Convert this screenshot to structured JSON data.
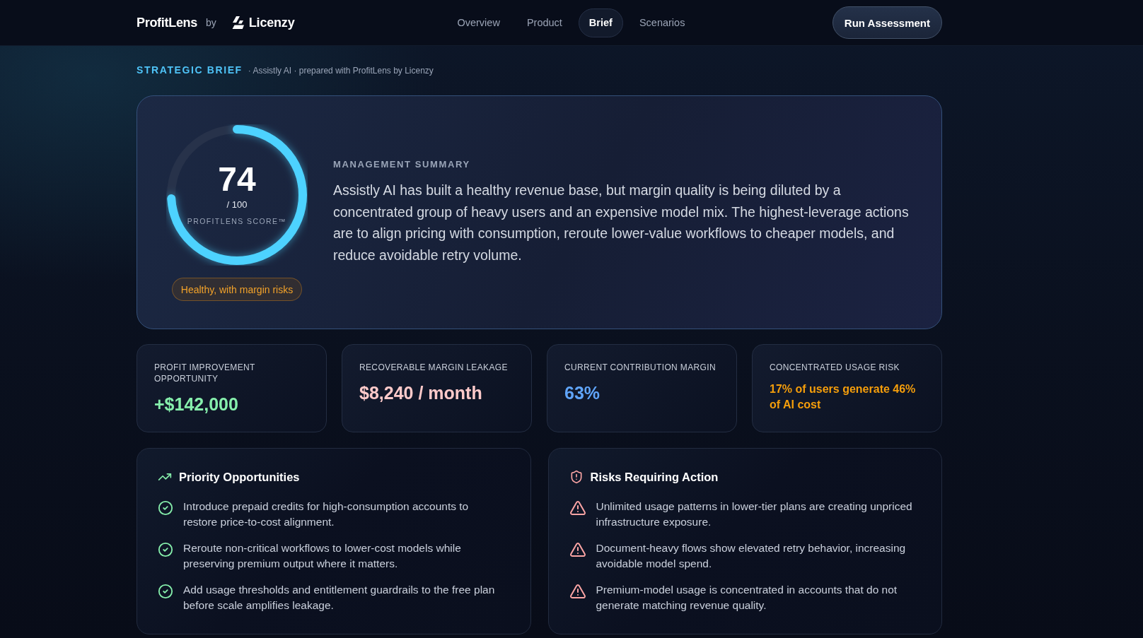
{
  "header": {
    "brand": "ProfitLens",
    "by": "by",
    "partner": "Licenzy",
    "nav": [
      {
        "label": "Overview",
        "selected": false
      },
      {
        "label": "Product",
        "selected": false
      },
      {
        "label": "Brief",
        "selected": true
      },
      {
        "label": "Scenarios",
        "selected": false
      }
    ],
    "cta": "Run Assessment"
  },
  "breadcrumb": {
    "title": "STRATEGIC BRIEF",
    "subtitle": "· Assistly AI · prepared with ProfitLens by Licenzy"
  },
  "score": {
    "value": "74",
    "scale": "/ 100",
    "label": "PROFITLENS SCORE™",
    "level": 0.74,
    "status": "Healthy, with margin risks"
  },
  "summary": {
    "label": "MANAGEMENT SUMMARY",
    "text": "Assistly AI has built a healthy revenue base, but margin quality is being diluted by a concentrated group of heavy users and an expensive model mix. The highest-leverage actions are to align pricing with consumption, reroute lower-value workflows to cheaper models, and reduce avoidable retry volume."
  },
  "metrics": [
    {
      "label": "PROFIT IMPROVEMENT OPPORTUNITY",
      "value": "+$142,000",
      "kind": "figure",
      "color": "#86efac"
    },
    {
      "label": "RECOVERABLE MARGIN LEAKAGE",
      "value": "$8,240 / month",
      "kind": "figure",
      "color": "#fecaca"
    },
    {
      "label": "CURRENT CONTRIBUTION MARGIN",
      "value": "63%",
      "kind": "figure",
      "color": "#60a5fa"
    },
    {
      "label": "CONCENTRATED USAGE RISK",
      "value": "17% of users generate 46% of AI cost",
      "kind": "statement",
      "color": "#f59e0b"
    }
  ],
  "panels": [
    {
      "kind": "opportunities",
      "title": "Priority Opportunities",
      "items": [
        "Introduce prepaid credits for high-consumption accounts to restore price-to-cost alignment.",
        "Reroute non-critical workflows to lower-cost models while preserving premium output where it matters.",
        "Add usage thresholds and entitlement guardrails to the free plan before scale amplifies leakage."
      ]
    },
    {
      "kind": "risks",
      "title": "Risks Requiring Action",
      "items": [
        "Unlimited usage patterns in lower-tier plans are creating unpriced infrastructure exposure.",
        "Document-heavy flows show elevated retry behavior, increasing avoidable model spend.",
        "Premium-model usage is concentrated in accounts that do not generate matching revenue quality."
      ]
    }
  ]
}
